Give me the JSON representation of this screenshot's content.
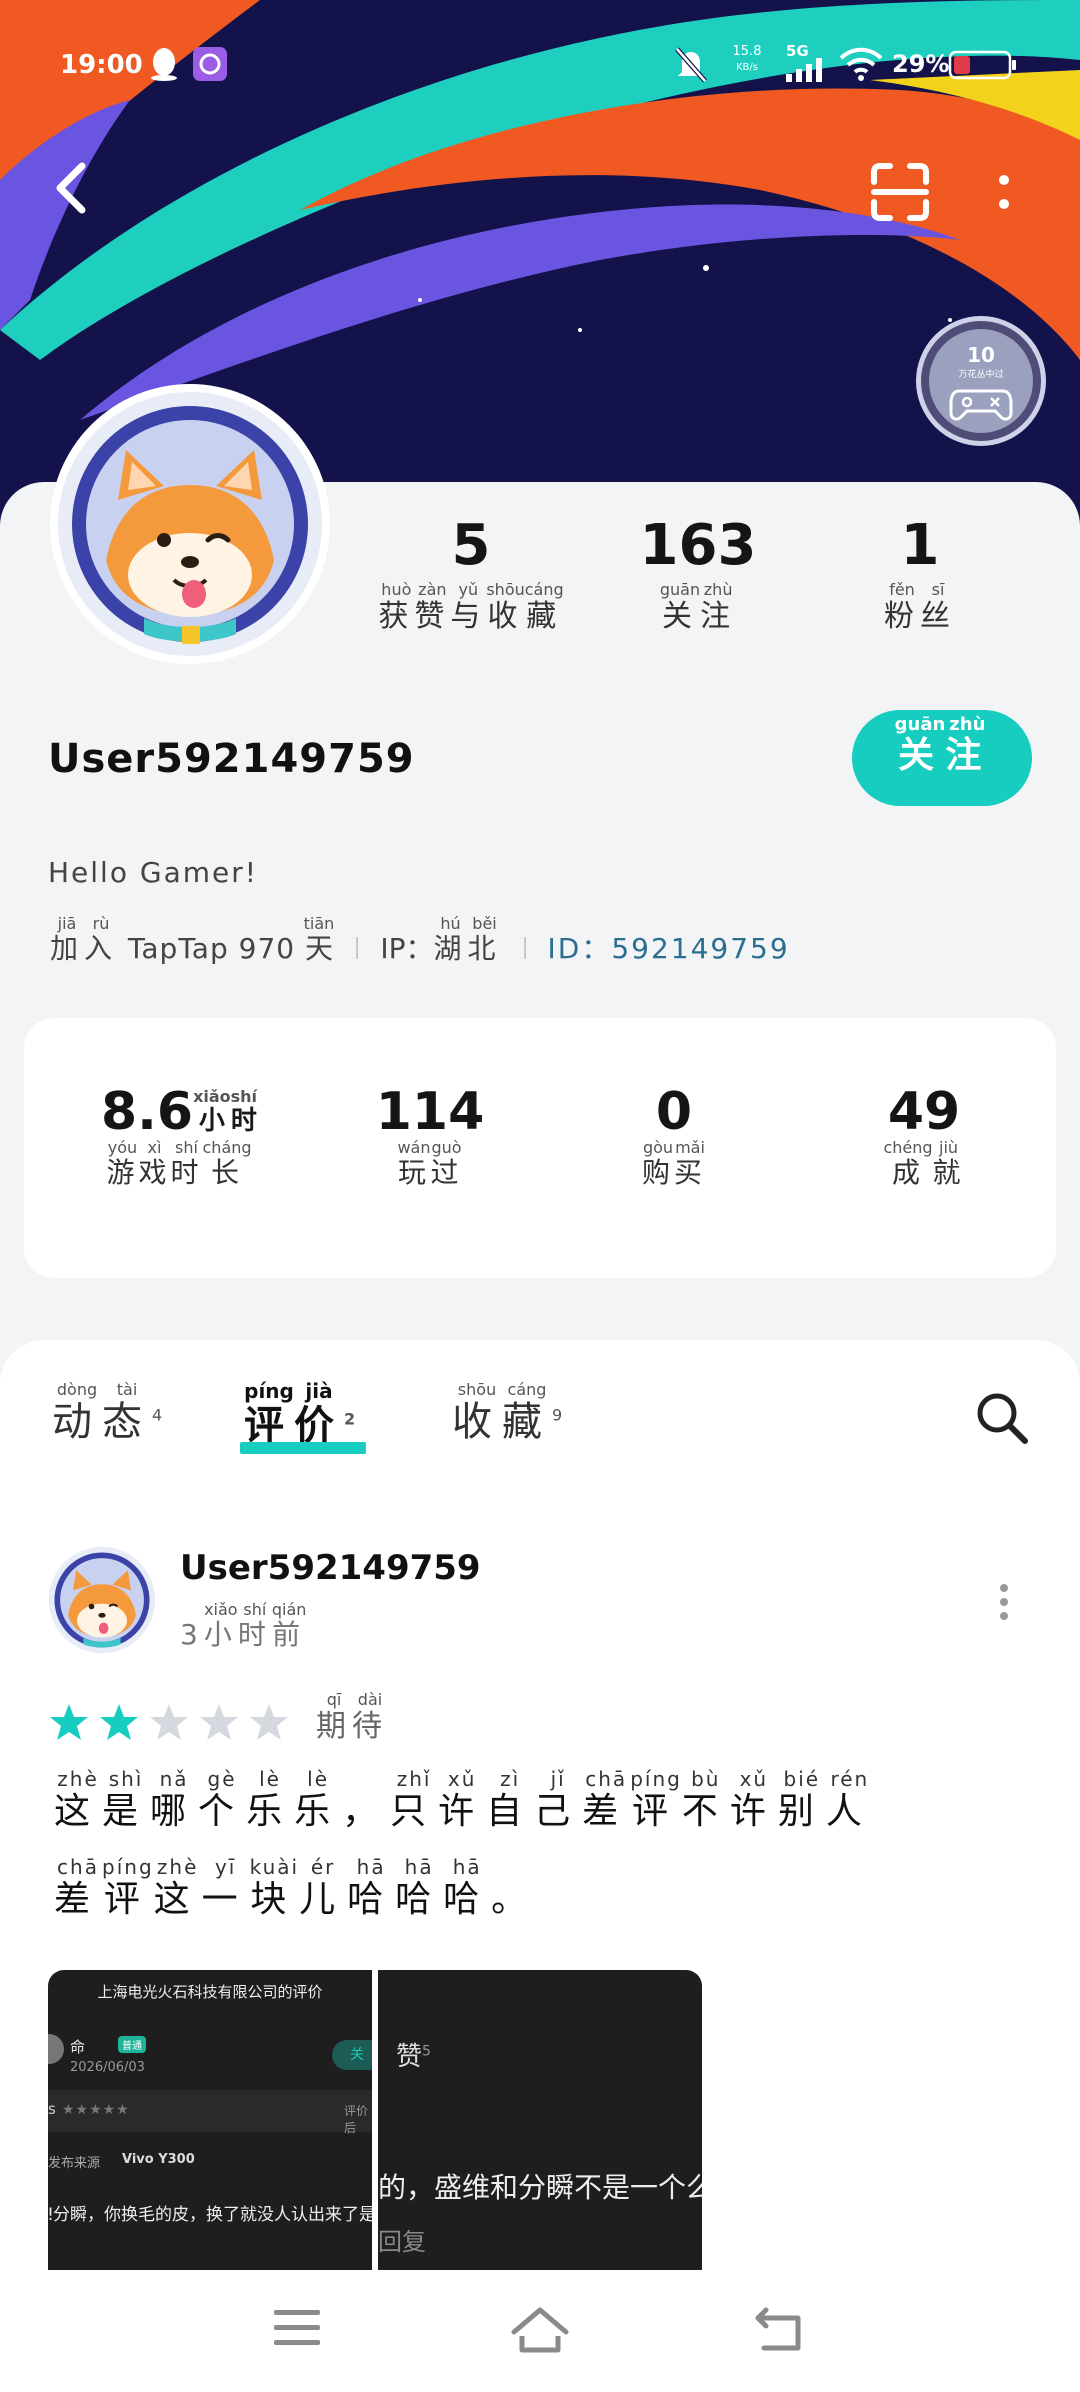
{
  "status_bar": {
    "time": "19:00",
    "net_speed_value": "15.8",
    "net_speed_unit": "KB/s",
    "network": "5G",
    "battery": "29%",
    "icons": [
      "qq-icon",
      "app-icon",
      "mute-bell-icon",
      "signal-icon",
      "wifi-icon",
      "battery-icon"
    ]
  },
  "header": {
    "back_icon": "back-arrow-icon",
    "scan_icon": "scan-icon",
    "more_icon": "more-vertical-icon",
    "badge_number": "10",
    "badge_text": "万花丛中过"
  },
  "profile": {
    "stats": [
      {
        "value": "5",
        "label": [
          [
            "获",
            "huò"
          ],
          [
            "赞",
            "zàn"
          ],
          [
            "与",
            "yǔ"
          ],
          [
            "收",
            "shōu"
          ],
          [
            "藏",
            "cáng"
          ]
        ]
      },
      {
        "value": "163",
        "label": [
          [
            "关",
            "guān"
          ],
          [
            "注",
            "zhù"
          ]
        ]
      },
      {
        "value": "1",
        "label": [
          [
            "粉",
            "fěn"
          ],
          [
            "丝",
            "sī"
          ]
        ]
      }
    ],
    "username": "User592149759",
    "follow_button": [
      [
        "关",
        "guān"
      ],
      [
        "注",
        "zhù"
      ]
    ],
    "bio": "Hello Gamer!",
    "join": {
      "prefix": [
        [
          "加",
          "jiā"
        ],
        [
          "入",
          "rù"
        ]
      ],
      "middle": " TapTap 970 ",
      "suffix": [
        [
          "天",
          "tiān"
        ]
      ]
    },
    "ip_label": "IP：",
    "ip_value": [
      [
        "湖",
        "hú"
      ],
      [
        "北",
        "běi"
      ]
    ],
    "id_text": "ID：592149759"
  },
  "game_stats": [
    {
      "value": "8.6",
      "unit": [
        [
          "小",
          "xiǎo"
        ],
        [
          "时",
          "shí"
        ]
      ],
      "label": [
        [
          "游",
          "yóu"
        ],
        [
          "戏",
          "xì"
        ],
        [
          "时",
          "shí"
        ],
        [
          "长",
          "cháng"
        ]
      ]
    },
    {
      "value": "114",
      "unit": [],
      "label": [
        [
          "玩",
          "wán"
        ],
        [
          "过",
          "guò"
        ]
      ]
    },
    {
      "value": "0",
      "unit": [],
      "label": [
        [
          "购",
          "gòu"
        ],
        [
          "买",
          "mǎi"
        ]
      ]
    },
    {
      "value": "49",
      "unit": [],
      "label": [
        [
          "成",
          "chéng"
        ],
        [
          "就",
          "jiù"
        ]
      ]
    }
  ],
  "tabs": [
    {
      "label": [
        [
          "动",
          "dòng"
        ],
        [
          "态",
          "tài"
        ]
      ],
      "count": "4",
      "active": false
    },
    {
      "label": [
        [
          "评",
          "píng"
        ],
        [
          "价",
          "jià"
        ]
      ],
      "count": "2",
      "active": true
    },
    {
      "label": [
        [
          "收",
          "shōu"
        ],
        [
          "藏",
          "cáng"
        ]
      ],
      "count": "9",
      "active": false
    }
  ],
  "search_icon": "search-icon",
  "post": {
    "username": "User592149759",
    "time_prefix": "3",
    "time": [
      [
        "小",
        "xiǎo"
      ],
      [
        "时",
        "shí"
      ],
      [
        "前",
        "qián"
      ]
    ],
    "rating": 2,
    "rating_max": 5,
    "rating_label": [
      [
        "期",
        "qī"
      ],
      [
        "待",
        "dài"
      ]
    ],
    "text_line1": [
      [
        "这",
        "zhè"
      ],
      [
        "是",
        "shì"
      ],
      [
        "哪",
        "nǎ"
      ],
      [
        "个",
        "gè"
      ],
      [
        "乐",
        "lè"
      ],
      [
        "乐",
        "lè"
      ],
      [
        "，",
        ""
      ],
      [
        "只",
        "zhǐ"
      ],
      [
        "许",
        "xǔ"
      ],
      [
        "自",
        "zì"
      ],
      [
        "己",
        "jǐ"
      ],
      [
        "差",
        "chā"
      ],
      [
        "评",
        "píng"
      ],
      [
        "不",
        "bù"
      ],
      [
        "许",
        "xǔ"
      ],
      [
        "别",
        "bié"
      ],
      [
        "人",
        "rén"
      ]
    ],
    "text_line2": [
      [
        "差",
        "chā"
      ],
      [
        "评",
        "píng"
      ],
      [
        "这",
        "zhè"
      ],
      [
        "一",
        "yī"
      ],
      [
        "块",
        "kuài"
      ],
      [
        "儿",
        "ér"
      ],
      [
        "哈",
        "hā"
      ],
      [
        "哈",
        "hā"
      ],
      [
        "哈",
        "hā"
      ],
      [
        "。",
        ""
      ]
    ],
    "screenshot1": {
      "header": "上海电光火石科技有限公司的评价",
      "name": "命",
      "tag": "普通",
      "date": "2026/06/03",
      "follow": "关",
      "label_left": "s",
      "stars": "★★★★★",
      "rating_text": "评价后",
      "source_label": "发布来源",
      "device": "Vivo Y300",
      "line": "ǃ分瞬，你换毛的皮，换了就没人认出来了是"
    },
    "screenshot2": {
      "zan": "赞",
      "zan_count": "5",
      "line": "的，盛维和分瞬不是一个么",
      "reply": "回复"
    }
  },
  "nav_bar": {
    "icons": [
      "menu-icon",
      "home-icon",
      "back-icon"
    ]
  },
  "colors": {
    "accent": "#17cdbf",
    "banner_dark": "#14124a",
    "banner_orange": "#f05a22",
    "banner_teal": "#1ecfc0",
    "banner_purple": "#6a55e0",
    "star_active": "#17cdbf",
    "star_inactive": "#d5d8de"
  }
}
